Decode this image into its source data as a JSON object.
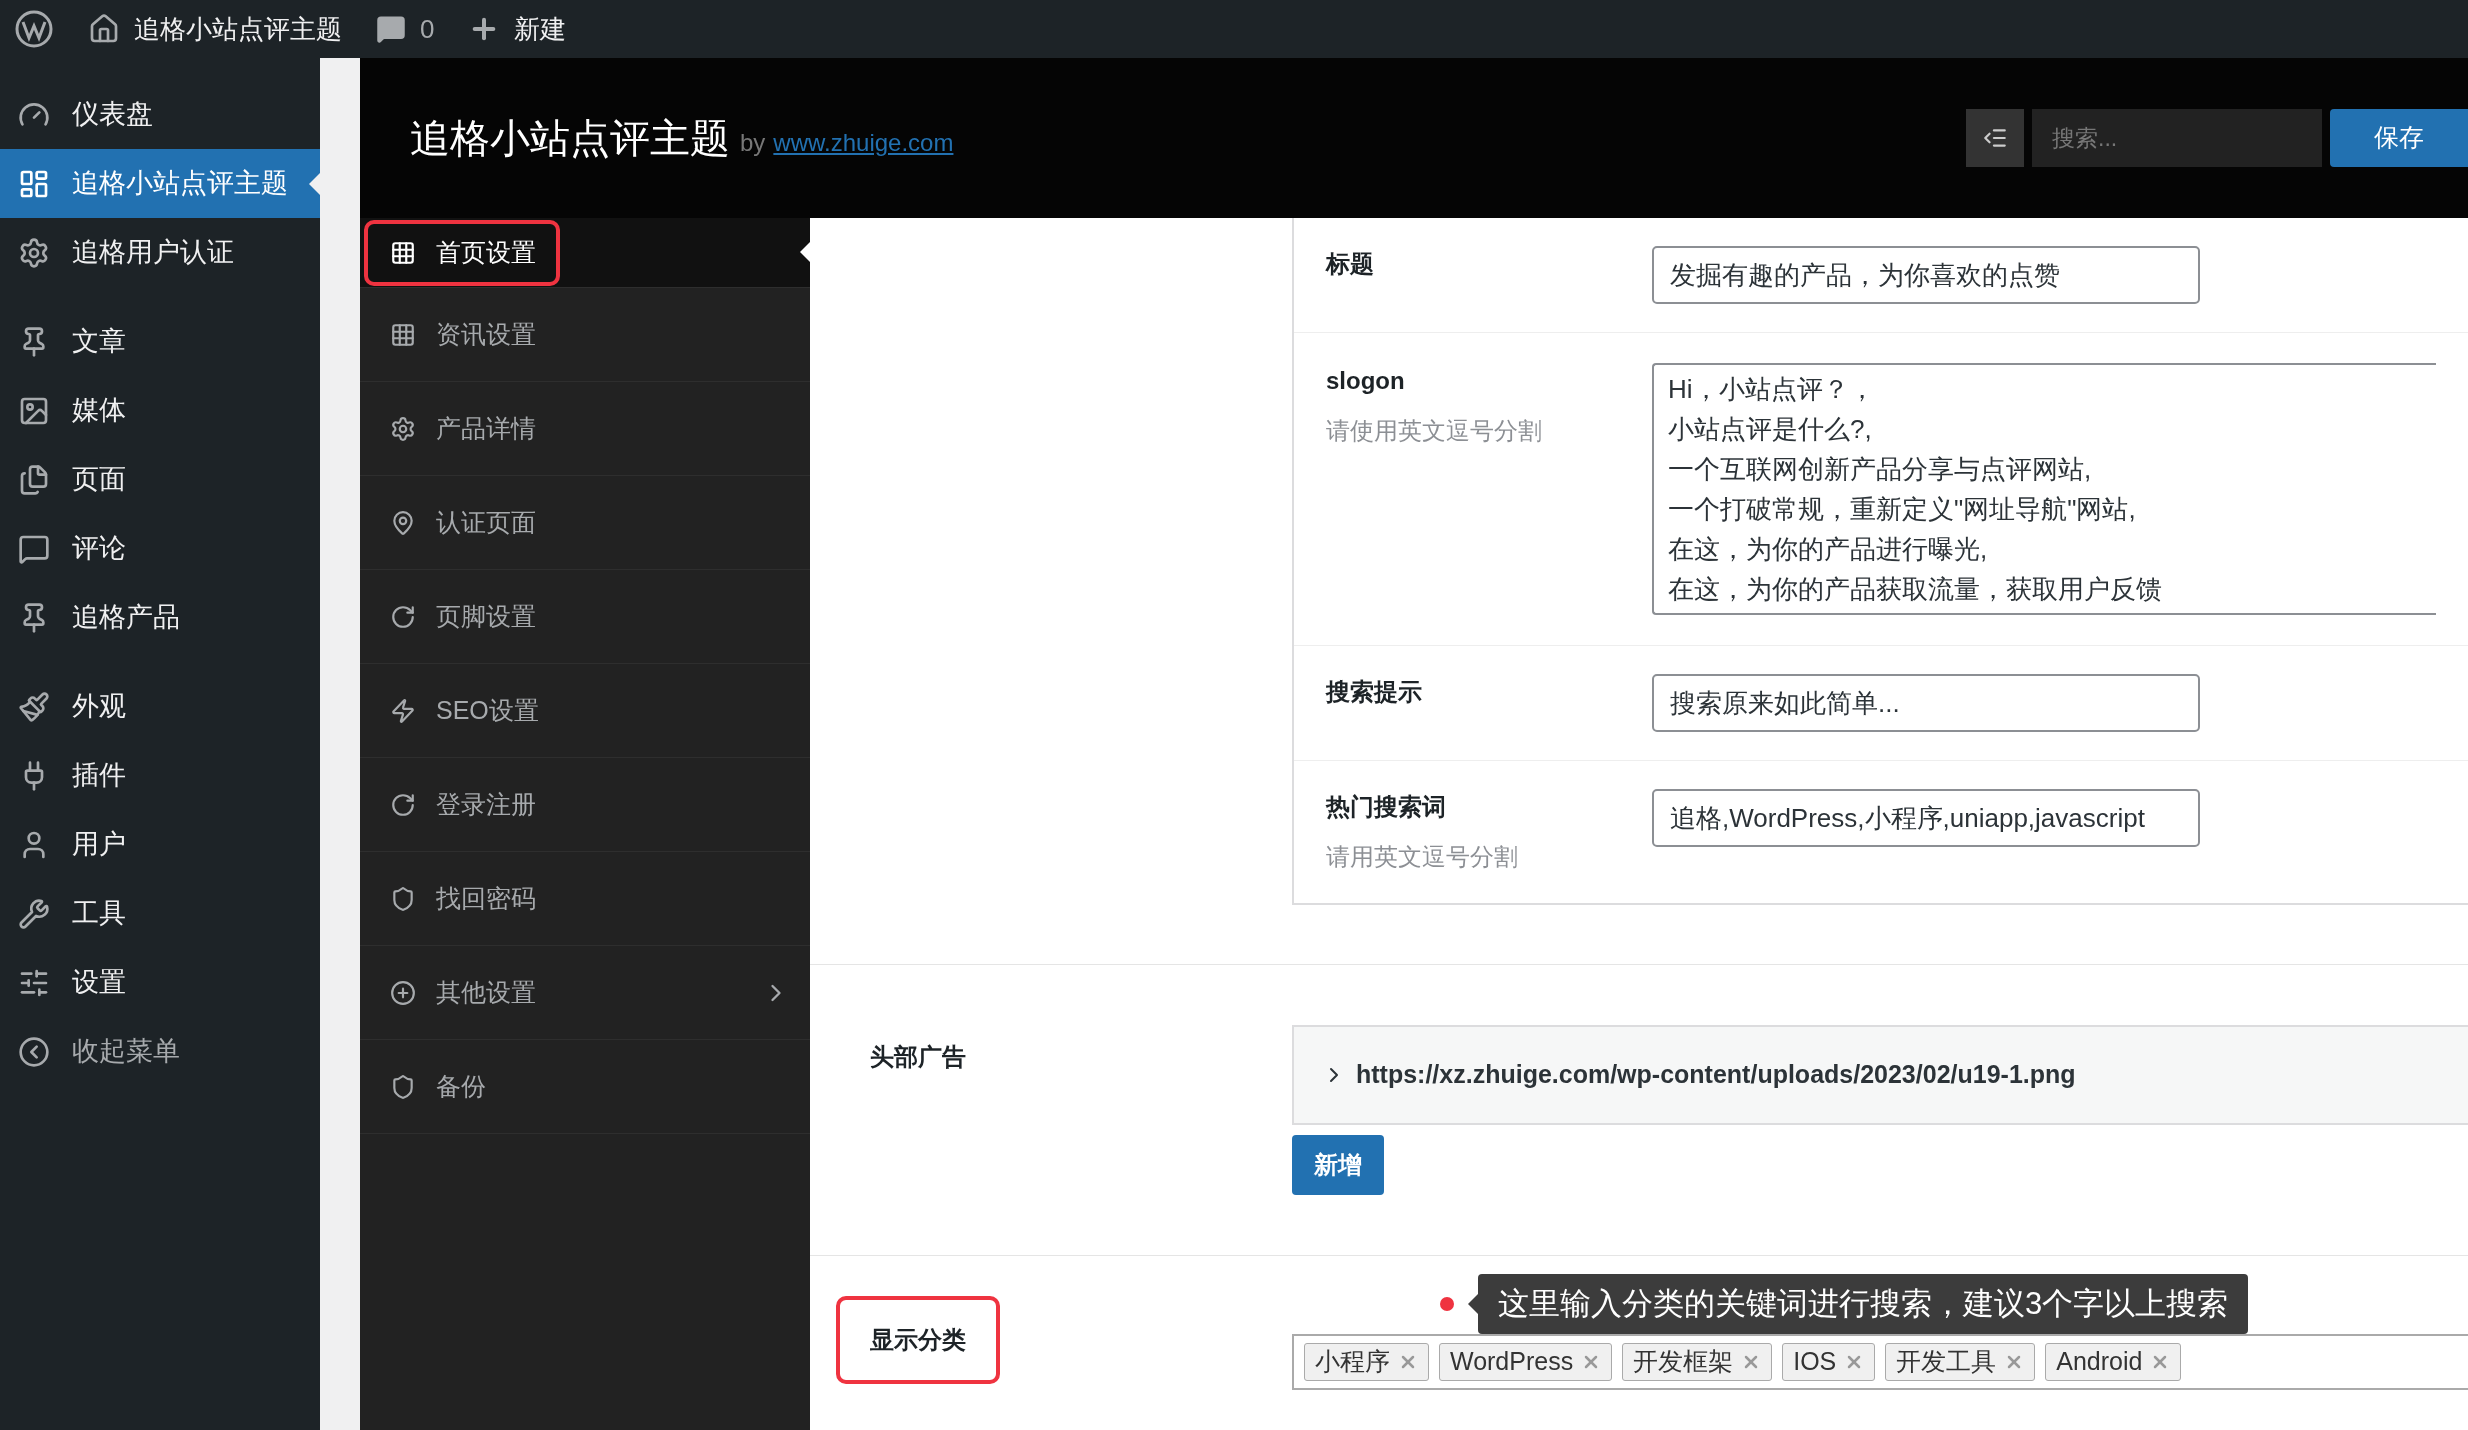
{
  "admin_bar": {
    "site_name": "追格小站点评主题",
    "comments": "0",
    "new_label": "新建"
  },
  "sidebar": {
    "groups": [
      [
        {
          "label": "仪表盘",
          "selected": false
        },
        {
          "label": "追格小站点评主题",
          "selected": true
        },
        {
          "label": "追格用户认证",
          "selected": false
        }
      ],
      [
        {
          "label": "文章",
          "selected": false
        },
        {
          "label": "媒体",
          "selected": false
        },
        {
          "label": "页面",
          "selected": false
        },
        {
          "label": "评论",
          "selected": false
        },
        {
          "label": "追格产品",
          "selected": false
        }
      ],
      [
        {
          "label": "外观",
          "selected": false
        },
        {
          "label": "插件",
          "selected": false
        },
        {
          "label": "用户",
          "selected": false
        },
        {
          "label": "工具",
          "selected": false
        },
        {
          "label": "设置",
          "selected": false
        },
        {
          "label": "收起菜单",
          "selected": false
        }
      ]
    ]
  },
  "header": {
    "title": "追格小站点评主题",
    "by": "by",
    "link": "www.zhuige.com",
    "search_placeholder": "搜索...",
    "save": "保存"
  },
  "nav": [
    {
      "label": "首页设置",
      "selected": true,
      "outlined": true,
      "has_submenu": false
    },
    {
      "label": "资讯设置",
      "selected": false,
      "outlined": false,
      "has_submenu": false
    },
    {
      "label": "产品详情",
      "selected": false,
      "outlined": false,
      "has_submenu": false
    },
    {
      "label": "认证页面",
      "selected": false,
      "outlined": false,
      "has_submenu": false
    },
    {
      "label": "页脚设置",
      "selected": false,
      "outlined": false,
      "has_submenu": false
    },
    {
      "label": "SEO设置",
      "selected": false,
      "outlined": false,
      "has_submenu": false
    },
    {
      "label": "登录注册",
      "selected": false,
      "outlined": false,
      "has_submenu": false
    },
    {
      "label": "找回密码",
      "selected": false,
      "outlined": false,
      "has_submenu": false
    },
    {
      "label": "其他设置",
      "selected": false,
      "outlined": false,
      "has_submenu": true
    },
    {
      "label": "备份",
      "selected": false,
      "outlined": false,
      "has_submenu": false
    }
  ],
  "fields": [
    {
      "kind": "input",
      "label": "标题",
      "value": "发掘有趣的产品，为你喜欢的点赞"
    },
    {
      "kind": "textarea",
      "label": "slogon",
      "hint": "请使用英文逗号分割",
      "lines": [
        "Hi，小站点评？，",
        "小站点评是什么?,",
        "一个互联网创新产品分享与点评网站,",
        "一个打破常规，重新定义\"网址导航\"网站,",
        "在这，为你的产品进行曝光,",
        "在这，为你的产品获取流量，获取用户反馈"
      ]
    },
    {
      "kind": "input",
      "label": "搜索提示",
      "value": "搜索原来如此简单..."
    },
    {
      "kind": "input",
      "label": "热门搜索词",
      "hint": "请用英文逗号分割",
      "value": "追格,WordPress,小程序,uniapp,javascript"
    }
  ],
  "header_ad": {
    "label": "头部广告",
    "items": [
      {
        "url": "https://xz.zhuige.com/wp-content/uploads/2023/02/u19-1.png",
        "expanded": false
      }
    ],
    "add": "新增"
  },
  "categories": {
    "label": "显示分类",
    "outlined": true,
    "tooltip": "这里输入分类的关键词进行搜索，建议3个字以上搜索",
    "tags": [
      "小程序",
      "WordPress",
      "开发框架",
      "IOS",
      "开发工具",
      "Android"
    ]
  }
}
